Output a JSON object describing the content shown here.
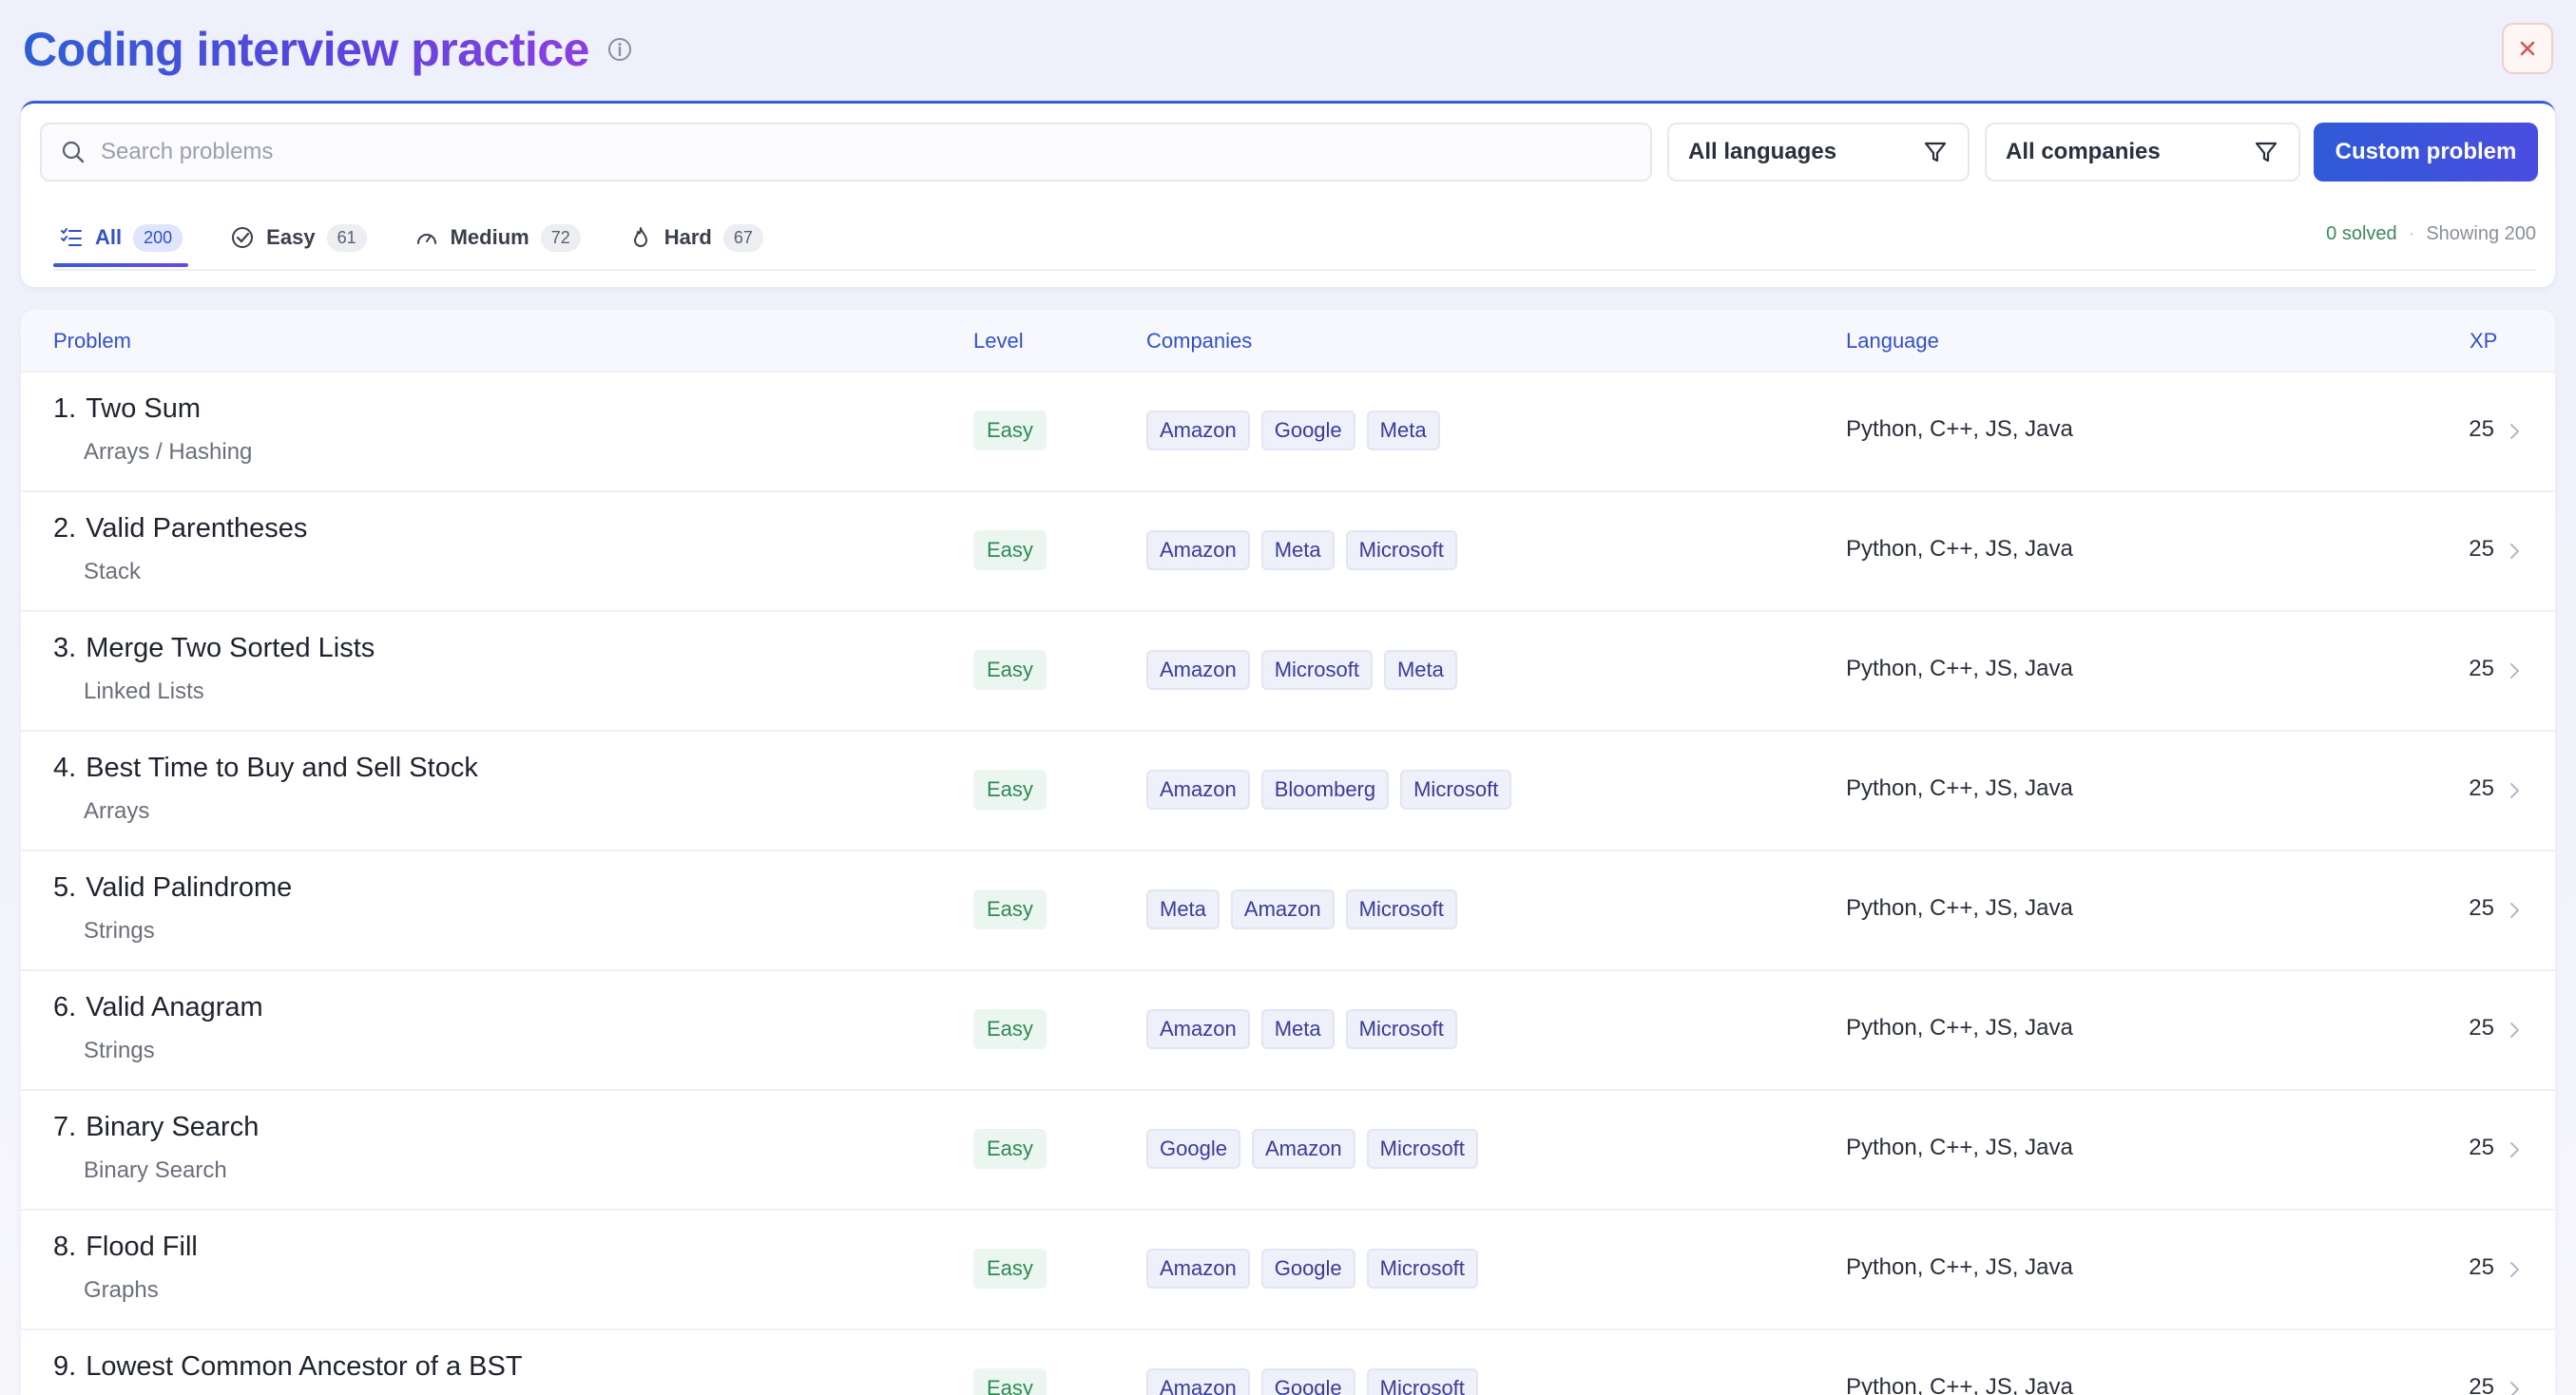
{
  "header": {
    "title": "Coding interview practice"
  },
  "toolbar": {
    "search_placeholder": "Search problems",
    "language_filter": "All languages",
    "company_filter": "All companies",
    "custom_button": "Custom problem"
  },
  "tabs": [
    {
      "label": "All",
      "count": "200",
      "icon": "checklist-icon",
      "active": true
    },
    {
      "label": "Easy",
      "count": "61",
      "icon": "check-circle-icon",
      "active": false
    },
    {
      "label": "Medium",
      "count": "72",
      "icon": "gauge-icon",
      "active": false
    },
    {
      "label": "Hard",
      "count": "67",
      "icon": "flame-icon",
      "active": false
    }
  ],
  "stats": {
    "solved": "0 solved",
    "separator": "·",
    "showing": "Showing 200"
  },
  "table": {
    "headers": {
      "problem": "Problem",
      "level": "Level",
      "companies": "Companies",
      "language": "Language",
      "xp": "XP"
    },
    "rows": [
      {
        "num": "1.",
        "title": "Two Sum",
        "topic": "Arrays / Hashing",
        "level": "Easy",
        "companies": [
          "Amazon",
          "Google",
          "Meta"
        ],
        "language": "Python, C++, JS, Java",
        "xp": "25"
      },
      {
        "num": "2.",
        "title": "Valid Parentheses",
        "topic": "Stack",
        "level": "Easy",
        "companies": [
          "Amazon",
          "Meta",
          "Microsoft"
        ],
        "language": "Python, C++, JS, Java",
        "xp": "25"
      },
      {
        "num": "3.",
        "title": "Merge Two Sorted Lists",
        "topic": "Linked Lists",
        "level": "Easy",
        "companies": [
          "Amazon",
          "Microsoft",
          "Meta"
        ],
        "language": "Python, C++, JS, Java",
        "xp": "25"
      },
      {
        "num": "4.",
        "title": "Best Time to Buy and Sell Stock",
        "topic": "Arrays",
        "level": "Easy",
        "companies": [
          "Amazon",
          "Bloomberg",
          "Microsoft"
        ],
        "language": "Python, C++, JS, Java",
        "xp": "25"
      },
      {
        "num": "5.",
        "title": "Valid Palindrome",
        "topic": "Strings",
        "level": "Easy",
        "companies": [
          "Meta",
          "Amazon",
          "Microsoft"
        ],
        "language": "Python, C++, JS, Java",
        "xp": "25"
      },
      {
        "num": "6.",
        "title": "Valid Anagram",
        "topic": "Strings",
        "level": "Easy",
        "companies": [
          "Amazon",
          "Meta",
          "Microsoft"
        ],
        "language": "Python, C++, JS, Java",
        "xp": "25"
      },
      {
        "num": "7.",
        "title": "Binary Search",
        "topic": "Binary Search",
        "level": "Easy",
        "companies": [
          "Google",
          "Amazon",
          "Microsoft"
        ],
        "language": "Python, C++, JS, Java",
        "xp": "25"
      },
      {
        "num": "8.",
        "title": "Flood Fill",
        "topic": "Graphs",
        "level": "Easy",
        "companies": [
          "Amazon",
          "Google",
          "Microsoft"
        ],
        "language": "Python, C++, JS, Java",
        "xp": "25"
      },
      {
        "num": "9.",
        "title": "Lowest Common Ancestor of a BST",
        "topic": "",
        "level": "Easy",
        "companies": [
          "Amazon",
          "Google",
          "Microsoft"
        ],
        "language": "Python, C++, JS, Java",
        "xp": "25"
      }
    ]
  },
  "colors": {
    "accent": "#3350cc",
    "easy": "#2f8a55",
    "close": "#d9534f"
  }
}
